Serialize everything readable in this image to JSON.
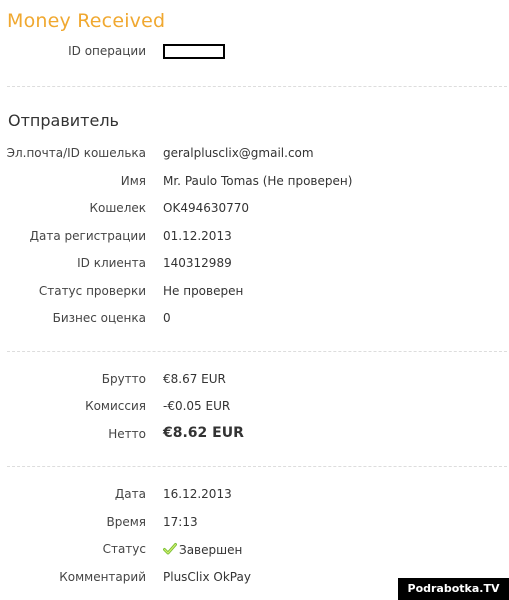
{
  "header": {
    "title": "Money Received"
  },
  "operation": {
    "id_label": "ID операции"
  },
  "sender": {
    "title": "Отправитель",
    "fields": [
      {
        "label": "Эл.почта/ID кошелька",
        "value": "geralplusclix@gmail.com"
      },
      {
        "label": "Имя",
        "value": "Mr. Paulo Tomas (Не проверен)"
      },
      {
        "label": "Кошелек",
        "value": "OK494630770"
      },
      {
        "label": "Дата регистрации",
        "value": "01.12.2013"
      },
      {
        "label": "ID клиента",
        "value": "140312989"
      },
      {
        "label": "Статус проверки",
        "value": "Не проверен"
      },
      {
        "label": "Бизнес оценка",
        "value": "0"
      }
    ]
  },
  "amounts": {
    "gross_label": "Брутто",
    "gross_value": "€8.67 EUR",
    "fee_label": "Комиссия",
    "fee_value": "-€0.05 EUR",
    "net_label": "Нетто",
    "net_value": "€8.62 EUR"
  },
  "details": {
    "date_label": "Дата",
    "date_value": "16.12.2013",
    "time_label": "Время",
    "time_value": "17:13",
    "status_label": "Статус",
    "status_value": "Завершен",
    "comment_label": "Комментарий",
    "comment_value": "PlusClix OkPay"
  },
  "watermark": {
    "text": "Podrabotka.TV"
  }
}
